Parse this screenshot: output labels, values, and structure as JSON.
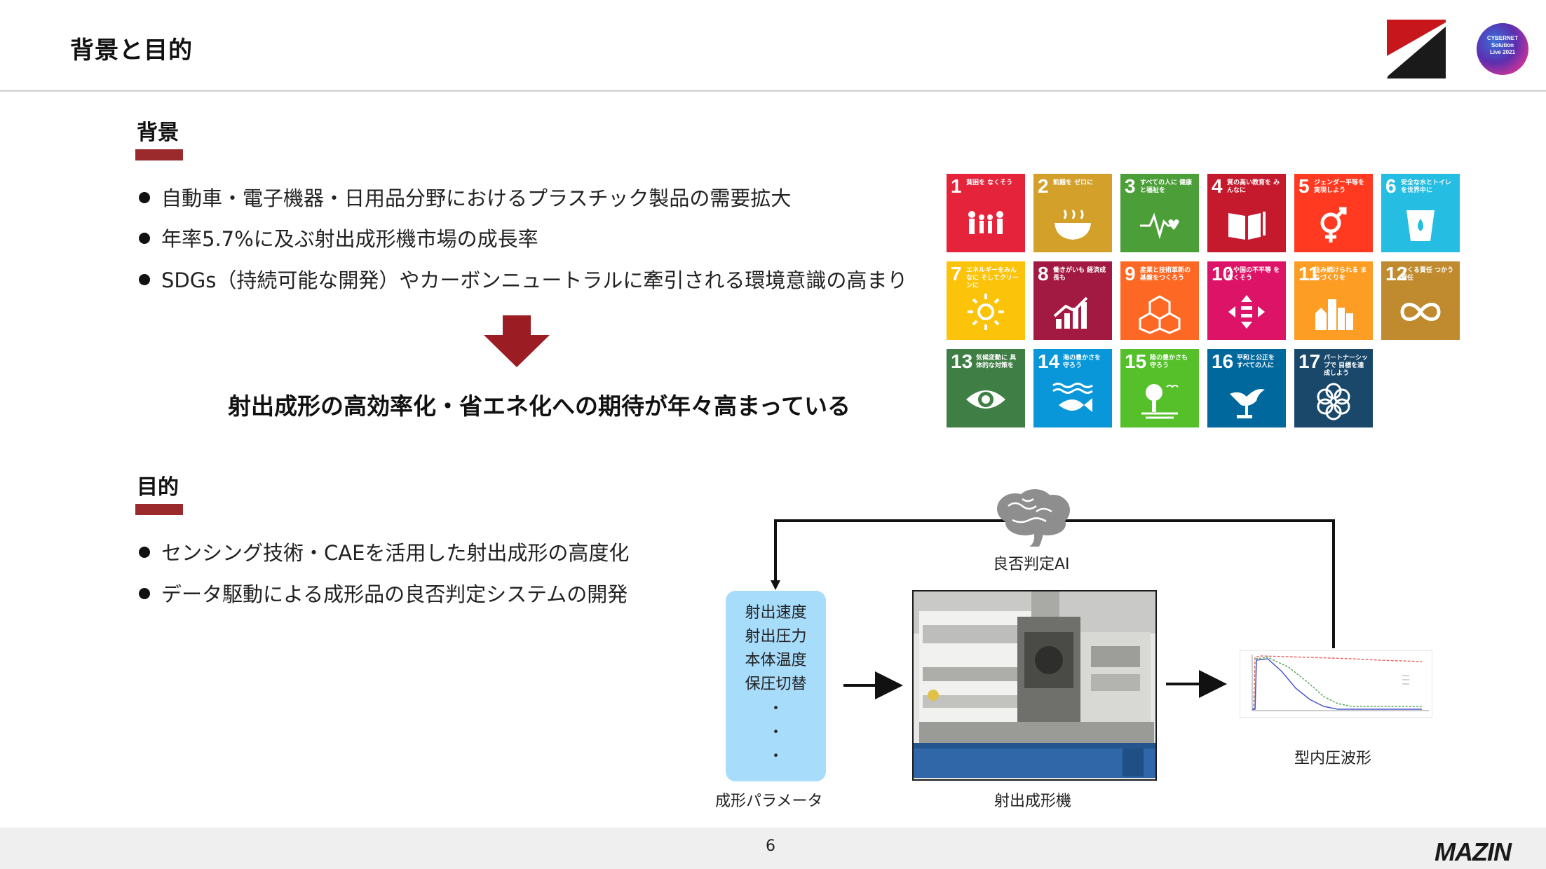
{
  "header": {
    "title": "背景と目的"
  },
  "background": {
    "heading": "背景",
    "bullets": [
      "自動車・電子機器・日用品分野におけるプラスチック製品の需要拡大",
      "年率5.7%に及ぶ射出成形機市場の成長率",
      "SDGs（持続可能な開発）やカーボンニュートラルに牽引される環境意識の高まり"
    ],
    "conclusion": "射出成形の高効率化・省エネ化への期待が年々高まっている"
  },
  "sdgs": [
    {
      "num": "1",
      "label": "貧困を なくそう",
      "color": "#e5243b"
    },
    {
      "num": "2",
      "label": "飢餓を ゼロに",
      "color": "#d3a029"
    },
    {
      "num": "3",
      "label": "すべての人に 健康と福祉を",
      "color": "#4c9f38"
    },
    {
      "num": "4",
      "label": "質の高い教育を みんなに",
      "color": "#c5192d"
    },
    {
      "num": "5",
      "label": "ジェンダー平等を 実現しよう",
      "color": "#ff3a21"
    },
    {
      "num": "6",
      "label": "安全な水とトイレ を世界中に",
      "color": "#26bde2"
    },
    {
      "num": "7",
      "label": "エネルギーをみんなに そしてクリーンに",
      "color": "#fcc30b"
    },
    {
      "num": "8",
      "label": "働きがいも 経済成長も",
      "color": "#a21942"
    },
    {
      "num": "9",
      "label": "産業と技術革新の 基盤をつくろう",
      "color": "#fd6925"
    },
    {
      "num": "10",
      "label": "人や国の不平等 をなくそう",
      "color": "#dd1367"
    },
    {
      "num": "11",
      "label": "住み続けられる まちづくりを",
      "color": "#fd9d24"
    },
    {
      "num": "12",
      "label": "つくる責任 つかう責任",
      "color": "#bf8b2e"
    },
    {
      "num": "13",
      "label": "気候変動に 具体的な対策を",
      "color": "#3f7e44"
    },
    {
      "num": "14",
      "label": "海の豊かさを 守ろう",
      "color": "#0a97d9"
    },
    {
      "num": "15",
      "label": "陸の豊かさも 守ろう",
      "color": "#56c02b"
    },
    {
      "num": "16",
      "label": "平和と公正を すべての人に",
      "color": "#00689d"
    },
    {
      "num": "17",
      "label": "パートナーシップで 目標を達成しよう",
      "color": "#19486a"
    }
  ],
  "purpose": {
    "heading": "目的",
    "bullets": [
      "センシング技術・CAEを活用した射出成形の高度化",
      "データ駆動による成形品の良否判定システムの開発"
    ]
  },
  "diagram": {
    "ai_label": "良否判定AI",
    "params": [
      "射出速度",
      "射出圧力",
      "本体温度",
      "保圧切替",
      "・",
      "・",
      "・"
    ],
    "params_caption": "成形パラメータ",
    "machine_caption": "射出成形機",
    "waveform_caption": "型内圧波形"
  },
  "logos": {
    "event_badge": [
      "CYBERNET",
      "Solution",
      "Live 2021"
    ],
    "footer_logo": "MAZIN"
  },
  "footer": {
    "page_number": "6"
  }
}
